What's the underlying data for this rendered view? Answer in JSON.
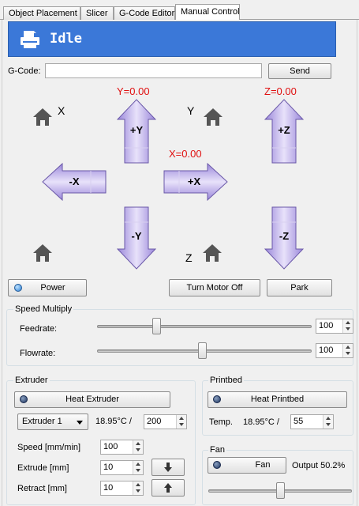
{
  "tabs": [
    "Object Placement",
    "Slicer",
    "G-Code Editor",
    "Manual Control"
  ],
  "status": {
    "text": "Idle"
  },
  "gcode": {
    "label": "G-Code:",
    "value": "",
    "send": "Send"
  },
  "jog": {
    "y_pos": "Y=0.00",
    "z_pos": "Z=0.00",
    "x_pos": "X=0.00",
    "plus_y": "+Y",
    "minus_y": "-Y",
    "plus_x": "+X",
    "minus_x": "-X",
    "plus_z": "+Z",
    "minus_z": "-Z",
    "home_x": "X",
    "home_y": "Y",
    "home_z": "Z"
  },
  "buttons": {
    "power": "Power",
    "motor_off": "Turn Motor Off",
    "park": "Park"
  },
  "speed": {
    "title": "Speed Multiply",
    "feedrate_label": "Feedrate:",
    "feedrate_value": "100",
    "feedrate_fraction": 0.27,
    "flowrate_label": "Flowrate:",
    "flowrate_value": "100",
    "flowrate_fraction": 0.49
  },
  "extruder": {
    "title": "Extruder",
    "heat_button": "Heat Extruder",
    "selected": "Extruder 1",
    "temp": "18.95°C /",
    "target": "200",
    "speed_label": "Speed [mm/min]",
    "speed_value": "100",
    "extrude_label": "Extrude [mm]",
    "extrude_value": "10",
    "retract_label": "Retract [mm]",
    "retract_value": "10"
  },
  "printbed": {
    "title": "Printbed",
    "heat_button": "Heat Printbed",
    "temp_label": "Temp.",
    "temp": "18.95°C /",
    "target": "55"
  },
  "fan": {
    "title": "Fan",
    "button": "Fan",
    "output": "Output 50.2%",
    "fraction": 0.5
  },
  "colors": {
    "status_bg": "#3b78d8",
    "position_text": "#e01010",
    "arrow_fill": "#b6a6e6"
  }
}
